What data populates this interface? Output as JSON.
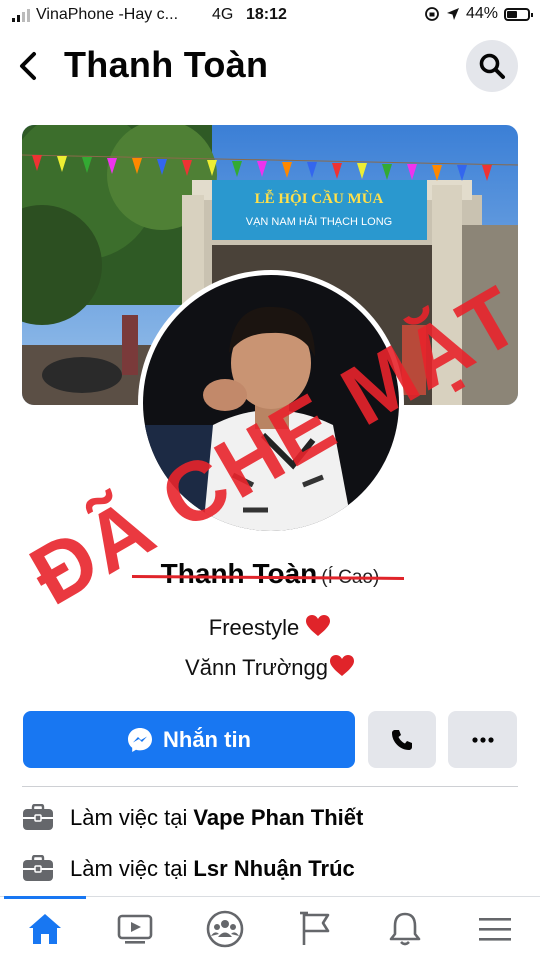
{
  "status_bar": {
    "carrier": "VinaPhone -Hay c...",
    "network": "4G",
    "time": "18:12",
    "battery": "44%",
    "battery_level": 0.44
  },
  "header": {
    "title": "Thanh Toàn"
  },
  "overlay_stamp": {
    "text": "ĐÃ CHE MẶT",
    "color": "#e8242b"
  },
  "cover": {
    "banner_line1": "LỄ HỘI CẦU MÙA",
    "banner_line2": "VẠN NAM HẢI THẠCH LONG"
  },
  "profile": {
    "name": "Thanh Toàn",
    "alt_name": "(Í Cao)",
    "bio_line1": "Freestyle",
    "bio_line2": "Vănn Trườngg"
  },
  "actions": {
    "message_label": "Nhắn tin"
  },
  "work": [
    {
      "prefix": "Làm việc tại",
      "place": "Vape Phan Thiết"
    },
    {
      "prefix": "Làm việc tại",
      "place": "Lsr Nhuận Trúc"
    }
  ],
  "colors": {
    "accent": "#1877f2",
    "button_gray": "#e4e6eb",
    "stamp_red": "#e8242b"
  },
  "tabs": [
    "home-icon",
    "watch-icon",
    "groups-icon",
    "pages-icon",
    "notifications-icon",
    "menu-icon"
  ]
}
